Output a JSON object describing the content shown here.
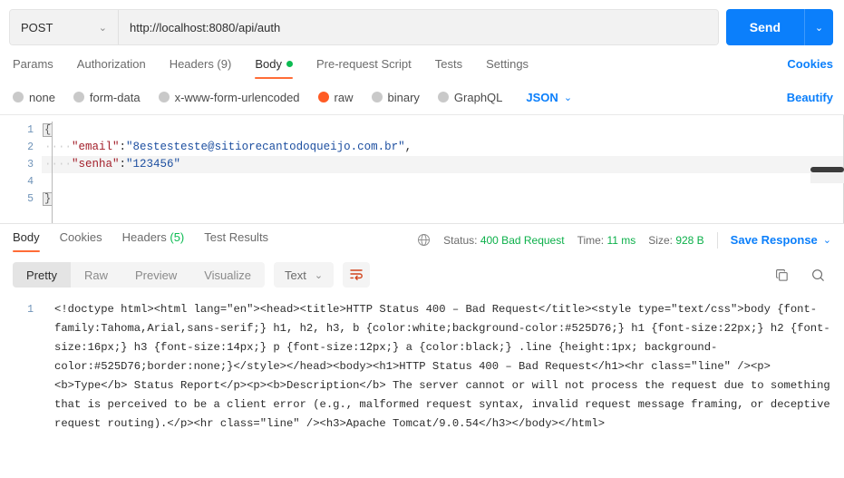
{
  "request": {
    "method": "POST",
    "url": "http://localhost:8080/api/auth",
    "send_label": "Send",
    "send_caret": "⌄",
    "method_caret": "⌄",
    "tabs": [
      {
        "label": "Params",
        "active": false,
        "dot": false
      },
      {
        "label": "Authorization",
        "active": false,
        "dot": false
      },
      {
        "label": "Headers (9)",
        "active": false,
        "dot": false
      },
      {
        "label": "Body",
        "active": true,
        "dot": true
      },
      {
        "label": "Pre-request Script",
        "active": false,
        "dot": false
      },
      {
        "label": "Tests",
        "active": false,
        "dot": false
      },
      {
        "label": "Settings",
        "active": false,
        "dot": false
      }
    ],
    "cookies_link": "Cookies",
    "body_types": [
      {
        "label": "none",
        "selected": false
      },
      {
        "label": "form-data",
        "selected": false
      },
      {
        "label": "x-www-form-urlencoded",
        "selected": false
      },
      {
        "label": "raw",
        "selected": true
      },
      {
        "label": "binary",
        "selected": false
      },
      {
        "label": "GraphQL",
        "selected": false
      }
    ],
    "raw_format": "JSON",
    "raw_format_caret": "⌄",
    "beautify_label": "Beautify",
    "editor": {
      "line_numbers": [
        "1",
        "2",
        "3",
        "4",
        "5"
      ],
      "open_brace": "{",
      "close_brace": "}",
      "indent_dots": "····",
      "line2_key": "\"email\"",
      "line2_sep": ":",
      "line2_val": "\"8estesteste@sitiorecantodoqueijo.com.br\"",
      "line2_comma": ",",
      "line3_key": "\"senha\"",
      "line3_sep": ":",
      "line3_val": "\"123456\""
    }
  },
  "response": {
    "tabs": [
      {
        "label": "Body",
        "count": "",
        "active": true
      },
      {
        "label": "Cookies",
        "count": "",
        "active": false
      },
      {
        "label": "Headers ",
        "count": "(5)",
        "active": false
      },
      {
        "label": "Test Results",
        "count": "",
        "active": false
      }
    ],
    "status_label": "Status:",
    "status_value": "400 Bad Request",
    "time_label": "Time:",
    "time_value": "11 ms",
    "size_label": "Size:",
    "size_value": "928 B",
    "save_response": "Save Response",
    "save_caret": "⌄",
    "view_modes": [
      {
        "label": "Pretty",
        "active": true
      },
      {
        "label": "Raw",
        "active": false
      },
      {
        "label": "Preview",
        "active": false
      },
      {
        "label": "Visualize",
        "active": false
      }
    ],
    "content_type": "Text",
    "content_type_caret": "⌄",
    "line_numbers": [
      "1"
    ],
    "body_text": "<!doctype html><html lang=\"en\"><head><title>HTTP Status 400 – Bad Request</title><style type=\"text/css\">body {font-family:Tahoma,Arial,sans-serif;} h1, h2, h3, b {color:white;background-color:#525D76;} h1 {font-size:22px;} h2 {font-size:16px;} h3 {font-size:14px;} p {font-size:12px;} a {color:black;} .line {height:1px; background-color:#525D76;border:none;}</style></head><body><h1>HTTP Status 400 – Bad Request</h1><hr class=\"line\" /><p><b>Type</b> Status Report</p><p><b>Description</b> The server cannot or will not process the request due to something that is perceived to be a client error (e.g., malformed request syntax, invalid request message framing, or deceptive request routing).</p><hr class=\"line\" /><h3>Apache Tomcat/9.0.54</h3></body></html>"
  },
  "colors": {
    "accent_blue": "#0b7ffb",
    "accent_orange": "#ff6c37",
    "status_green": "#0cbb52",
    "radio_on": "#ff5b24"
  }
}
